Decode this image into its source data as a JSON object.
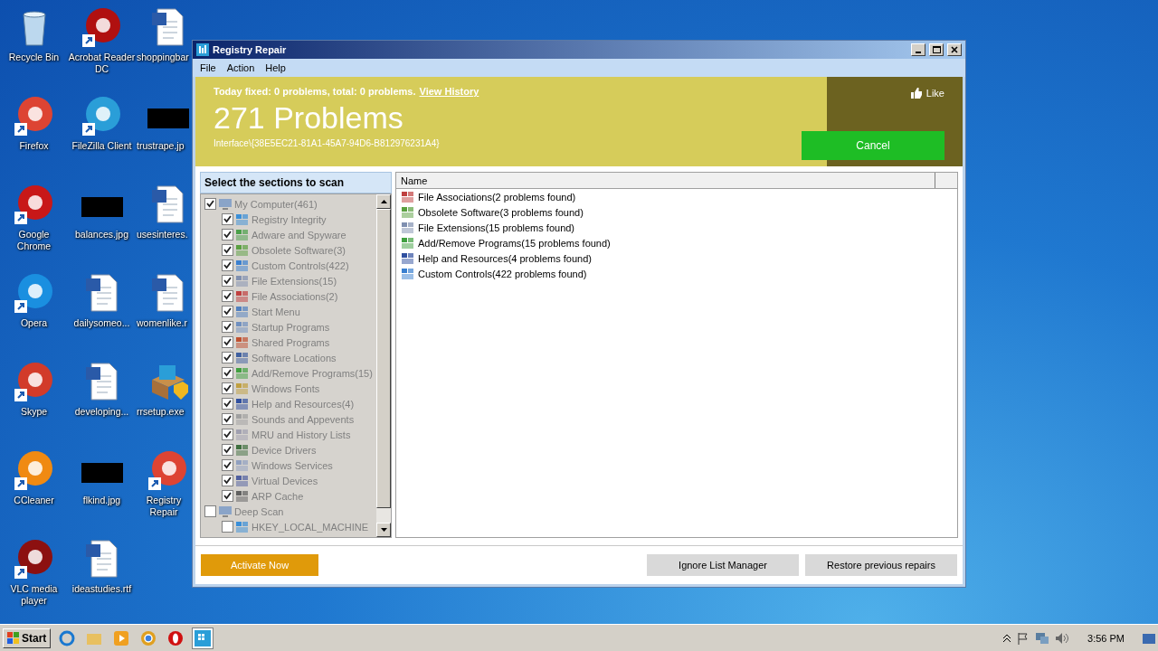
{
  "desktop_icons": [
    {
      "label": "Recycle Bin",
      "kind": "bin"
    },
    {
      "label": "Firefox",
      "kind": "app"
    },
    {
      "label": "Google Chrome",
      "kind": "app"
    },
    {
      "label": "Opera",
      "kind": "app"
    },
    {
      "label": "Skype",
      "kind": "app"
    },
    {
      "label": "CCleaner",
      "kind": "app"
    },
    {
      "label": "VLC media player",
      "kind": "app"
    },
    {
      "label": "Acrobat Reader DC",
      "kind": "app"
    },
    {
      "label": "FileZilla Client",
      "kind": "app"
    },
    {
      "label": "balances.jpg",
      "kind": "image"
    },
    {
      "label": "dailysomeo...",
      "kind": "document"
    },
    {
      "label": "developing...",
      "kind": "document"
    },
    {
      "label": "flkind.jpg",
      "kind": "image"
    },
    {
      "label": "ideastudies.rtf",
      "kind": "document"
    },
    {
      "label": "shoppingbar",
      "kind": "document"
    },
    {
      "label": "trustrape.jp",
      "kind": "image"
    },
    {
      "label": "usesinteres.",
      "kind": "document"
    },
    {
      "label": "womenlike.r",
      "kind": "document"
    },
    {
      "label": "rrsetup.exe",
      "kind": "installer"
    },
    {
      "label": "Registry Repair",
      "kind": "app"
    }
  ],
  "window": {
    "title": "Registry Repair",
    "menu": [
      "File",
      "Action",
      "Help"
    ],
    "banner": {
      "summary": "Today fixed: 0 problems, total: 0 problems.",
      "link": "View History",
      "count": "271 Problems",
      "path": "Interface\\{38E5EC21-81A1-45A7-94D6-B812976231A4}",
      "like": "Like",
      "cancel": "Cancel"
    },
    "sections": {
      "title": "Select the sections to scan",
      "tree": [
        {
          "label": "My Computer(461)",
          "checked": true,
          "children": [
            {
              "label": "Registry Integrity",
              "checked": true
            },
            {
              "label": "Adware and Spyware",
              "checked": true
            },
            {
              "label": "Obsolete Software(3)",
              "checked": true
            },
            {
              "label": "Custom Controls(422)",
              "checked": true
            },
            {
              "label": "File Extensions(15)",
              "checked": true
            },
            {
              "label": "File Associations(2)",
              "checked": true
            },
            {
              "label": "Start Menu",
              "checked": true
            },
            {
              "label": "Startup Programs",
              "checked": true
            },
            {
              "label": "Shared Programs",
              "checked": true
            },
            {
              "label": "Software Locations",
              "checked": true
            },
            {
              "label": "Add/Remove Programs(15)",
              "checked": true
            },
            {
              "label": "Windows Fonts",
              "checked": true
            },
            {
              "label": "Help and Resources(4)",
              "checked": true
            },
            {
              "label": "Sounds and Appevents",
              "checked": true
            },
            {
              "label": "MRU and History Lists",
              "checked": true
            },
            {
              "label": "Device Drivers",
              "checked": true
            },
            {
              "label": "Windows Services",
              "checked": true
            },
            {
              "label": "Virtual Devices",
              "checked": true
            },
            {
              "label": "ARP Cache",
              "checked": true
            }
          ]
        },
        {
          "label": "Deep Scan",
          "checked": false,
          "children": [
            {
              "label": "HKEY_LOCAL_MACHINE",
              "checked": false
            }
          ]
        }
      ]
    },
    "results": {
      "columns": [
        "Name"
      ],
      "items": [
        "File Associations(2 problems found)",
        "Obsolete Software(3 problems found)",
        "File Extensions(15 problems found)",
        "Add/Remove Programs(15 problems found)",
        "Help and Resources(4 problems found)",
        "Custom Controls(422 problems found)"
      ]
    },
    "buttons": {
      "activate": "Activate Now",
      "ignore": "Ignore List Manager",
      "restore": "Restore previous repairs"
    }
  },
  "taskbar": {
    "start": "Start",
    "time": "3:56 PM"
  }
}
